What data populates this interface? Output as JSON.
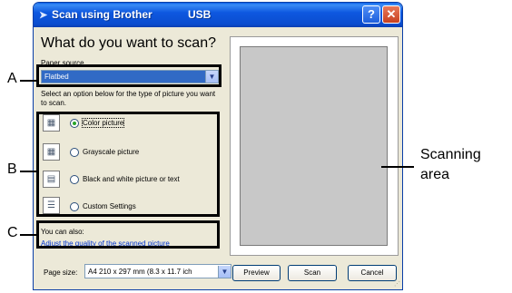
{
  "window": {
    "title": "Scan using Brother",
    "title_suffix": "USB",
    "help_label": "?",
    "close_label": "✕"
  },
  "panel": {
    "heading": "What do you want to scan?",
    "paper_source_label": "Paper source",
    "paper_source_value": "Flatbed",
    "select_hint": "Select an option below for the type of picture you want to scan.",
    "options": [
      {
        "label": "Color picture",
        "selected": true,
        "icon": "color-photo-icon"
      },
      {
        "label": "Grayscale picture",
        "selected": false,
        "icon": "grayscale-photo-icon"
      },
      {
        "label": "Black and white picture or text",
        "selected": false,
        "icon": "document-text-icon"
      },
      {
        "label": "Custom Settings",
        "selected": false,
        "icon": "custom-settings-icon"
      }
    ],
    "also_label": "You can also:",
    "adjust_link": "Adjust the quality of the scanned picture",
    "page_size_label": "Page size:",
    "page_size_value": "A4 210 x 297 mm (8.3 x 11.7 ich"
  },
  "buttons": {
    "preview": "Preview",
    "scan": "Scan",
    "cancel": "Cancel"
  },
  "annotations": {
    "a": "A",
    "b": "B",
    "c": "C",
    "scanning_area": "Scanning area"
  },
  "colors": {
    "titlebar": "#0a4ccf",
    "dialog_bg": "#ece9d8",
    "selection": "#316ac5",
    "preview_area": "#c8c8c8"
  }
}
